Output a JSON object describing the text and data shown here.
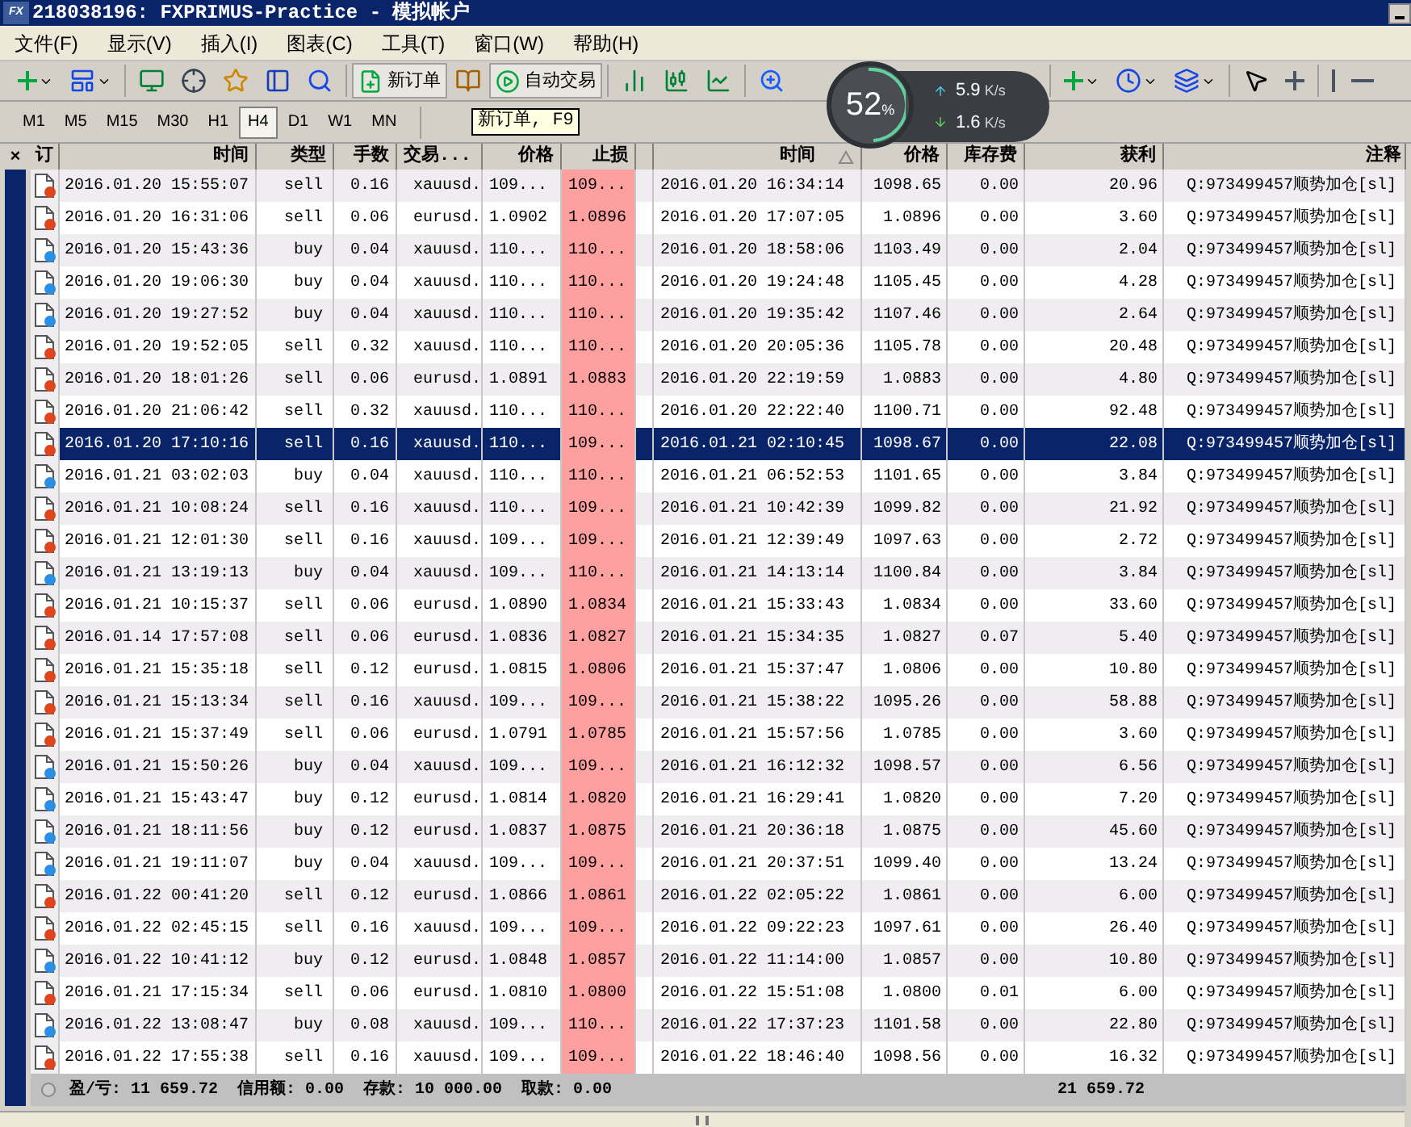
{
  "window": {
    "logo": "FX",
    "title": "218038196: FXPRIMUS-Practice - 模拟帐户"
  },
  "terminal_close": "×",
  "menu": [
    "文件(F)",
    "显示(V)",
    "插入(I)",
    "图表(C)",
    "工具(T)",
    "窗口(W)",
    "帮助(H)"
  ],
  "toolbar": {
    "new_order": "新订单",
    "auto_trading": "自动交易"
  },
  "timeframes": [
    {
      "label": "M1",
      "selected": false
    },
    {
      "label": "M5",
      "selected": false
    },
    {
      "label": "M15",
      "selected": false
    },
    {
      "label": "M30",
      "selected": false
    },
    {
      "label": "H1",
      "selected": false
    },
    {
      "label": "H4",
      "selected": true
    },
    {
      "label": "D1",
      "selected": false
    },
    {
      "label": "W1",
      "selected": false
    },
    {
      "label": "MN",
      "selected": false
    }
  ],
  "tooltip": "新订单, F9",
  "speed_widget": {
    "percent": "52",
    "percent_sign": "%",
    "upload": "5.9",
    "upload_unit": "K/s",
    "download": "1.6",
    "download_unit": "K/s"
  },
  "table": {
    "order_column": "订",
    "columns": [
      "时间",
      "类型",
      "手数",
      "交易...",
      "价格",
      "止损",
      "时间",
      "价格",
      "库存费",
      "获利",
      "注释"
    ],
    "rows": [
      {
        "kind": "sell",
        "selected": false,
        "cells": [
          "2016.01.20 15:55:07",
          "sell",
          "0.16",
          "xauusd.",
          "109...",
          "109...",
          "2016.01.20 16:34:14",
          "1098.65",
          "0.00",
          "20.96",
          "Q:973499457顺势加仓[sl]"
        ]
      },
      {
        "kind": "sell",
        "selected": false,
        "cells": [
          "2016.01.20 16:31:06",
          "sell",
          "0.06",
          "eurusd.",
          "1.0902",
          "1.0896",
          "2016.01.20 17:07:05",
          "1.0896",
          "0.00",
          "3.60",
          "Q:973499457顺势加仓[sl]"
        ]
      },
      {
        "kind": "buy",
        "selected": false,
        "cells": [
          "2016.01.20 15:43:36",
          "buy",
          "0.04",
          "xauusd.",
          "110...",
          "110...",
          "2016.01.20 18:58:06",
          "1103.49",
          "0.00",
          "2.04",
          "Q:973499457顺势加仓[sl]"
        ]
      },
      {
        "kind": "buy",
        "selected": false,
        "cells": [
          "2016.01.20 19:06:30",
          "buy",
          "0.04",
          "xauusd.",
          "110...",
          "110...",
          "2016.01.20 19:24:48",
          "1105.45",
          "0.00",
          "4.28",
          "Q:973499457顺势加仓[sl]"
        ]
      },
      {
        "kind": "buy",
        "selected": false,
        "cells": [
          "2016.01.20 19:27:52",
          "buy",
          "0.04",
          "xauusd.",
          "110...",
          "110...",
          "2016.01.20 19:35:42",
          "1107.46",
          "0.00",
          "2.64",
          "Q:973499457顺势加仓[sl]"
        ]
      },
      {
        "kind": "sell",
        "selected": false,
        "cells": [
          "2016.01.20 19:52:05",
          "sell",
          "0.32",
          "xauusd.",
          "110...",
          "110...",
          "2016.01.20 20:05:36",
          "1105.78",
          "0.00",
          "20.48",
          "Q:973499457顺势加仓[sl]"
        ]
      },
      {
        "kind": "sell",
        "selected": false,
        "cells": [
          "2016.01.20 18:01:26",
          "sell",
          "0.06",
          "eurusd.",
          "1.0891",
          "1.0883",
          "2016.01.20 22:19:59",
          "1.0883",
          "0.00",
          "4.80",
          "Q:973499457顺势加仓[sl]"
        ]
      },
      {
        "kind": "sell",
        "selected": false,
        "cells": [
          "2016.01.20 21:06:42",
          "sell",
          "0.32",
          "xauusd.",
          "110...",
          "110...",
          "2016.01.20 22:22:40",
          "1100.71",
          "0.00",
          "92.48",
          "Q:973499457顺势加仓[sl]"
        ]
      },
      {
        "kind": "sell",
        "selected": true,
        "cells": [
          "2016.01.20 17:10:16",
          "sell",
          "0.16",
          "xauusd.",
          "110...",
          "109...",
          "2016.01.21 02:10:45",
          "1098.67",
          "0.00",
          "22.08",
          "Q:973499457顺势加仓[sl]"
        ]
      },
      {
        "kind": "buy",
        "selected": false,
        "cells": [
          "2016.01.21 03:02:03",
          "buy",
          "0.04",
          "xauusd.",
          "110...",
          "110...",
          "2016.01.21 06:52:53",
          "1101.65",
          "0.00",
          "3.84",
          "Q:973499457顺势加仓[sl]"
        ]
      },
      {
        "kind": "sell",
        "selected": false,
        "cells": [
          "2016.01.21 10:08:24",
          "sell",
          "0.16",
          "xauusd.",
          "110...",
          "109...",
          "2016.01.21 10:42:39",
          "1099.82",
          "0.00",
          "21.92",
          "Q:973499457顺势加仓[sl]"
        ]
      },
      {
        "kind": "sell",
        "selected": false,
        "cells": [
          "2016.01.21 12:01:30",
          "sell",
          "0.16",
          "xauusd.",
          "109...",
          "109...",
          "2016.01.21 12:39:49",
          "1097.63",
          "0.00",
          "2.72",
          "Q:973499457顺势加仓[sl]"
        ]
      },
      {
        "kind": "buy",
        "selected": false,
        "cells": [
          "2016.01.21 13:19:13",
          "buy",
          "0.04",
          "xauusd.",
          "109...",
          "110...",
          "2016.01.21 14:13:14",
          "1100.84",
          "0.00",
          "3.84",
          "Q:973499457顺势加仓[sl]"
        ]
      },
      {
        "kind": "sell",
        "selected": false,
        "cells": [
          "2016.01.21 10:15:37",
          "sell",
          "0.06",
          "eurusd.",
          "1.0890",
          "1.0834",
          "2016.01.21 15:33:43",
          "1.0834",
          "0.00",
          "33.60",
          "Q:973499457顺势加仓[sl]"
        ]
      },
      {
        "kind": "sell",
        "selected": false,
        "cells": [
          "2016.01.14 17:57:08",
          "sell",
          "0.06",
          "eurusd.",
          "1.0836",
          "1.0827",
          "2016.01.21 15:34:35",
          "1.0827",
          "0.07",
          "5.40",
          "Q:973499457顺势加仓[sl]"
        ]
      },
      {
        "kind": "sell",
        "selected": false,
        "cells": [
          "2016.01.21 15:35:18",
          "sell",
          "0.12",
          "eurusd.",
          "1.0815",
          "1.0806",
          "2016.01.21 15:37:47",
          "1.0806",
          "0.00",
          "10.80",
          "Q:973499457顺势加仓[sl]"
        ]
      },
      {
        "kind": "sell",
        "selected": false,
        "cells": [
          "2016.01.21 15:13:34",
          "sell",
          "0.16",
          "xauusd.",
          "109...",
          "109...",
          "2016.01.21 15:38:22",
          "1095.26",
          "0.00",
          "58.88",
          "Q:973499457顺势加仓[sl]"
        ]
      },
      {
        "kind": "sell",
        "selected": false,
        "cells": [
          "2016.01.21 15:37:49",
          "sell",
          "0.06",
          "eurusd.",
          "1.0791",
          "1.0785",
          "2016.01.21 15:57:56",
          "1.0785",
          "0.00",
          "3.60",
          "Q:973499457顺势加仓[sl]"
        ]
      },
      {
        "kind": "buy",
        "selected": false,
        "cells": [
          "2016.01.21 15:50:26",
          "buy",
          "0.04",
          "xauusd.",
          "109...",
          "109...",
          "2016.01.21 16:12:32",
          "1098.57",
          "0.00",
          "6.56",
          "Q:973499457顺势加仓[sl]"
        ]
      },
      {
        "kind": "buy",
        "selected": false,
        "cells": [
          "2016.01.21 15:43:47",
          "buy",
          "0.12",
          "eurusd.",
          "1.0814",
          "1.0820",
          "2016.01.21 16:29:41",
          "1.0820",
          "0.00",
          "7.20",
          "Q:973499457顺势加仓[sl]"
        ]
      },
      {
        "kind": "buy",
        "selected": false,
        "cells": [
          "2016.01.21 18:11:56",
          "buy",
          "0.12",
          "eurusd.",
          "1.0837",
          "1.0875",
          "2016.01.21 20:36:18",
          "1.0875",
          "0.00",
          "45.60",
          "Q:973499457顺势加仓[sl]"
        ]
      },
      {
        "kind": "buy",
        "selected": false,
        "cells": [
          "2016.01.21 19:11:07",
          "buy",
          "0.04",
          "xauusd.",
          "109...",
          "109...",
          "2016.01.21 20:37:51",
          "1099.40",
          "0.00",
          "13.24",
          "Q:973499457顺势加仓[sl]"
        ]
      },
      {
        "kind": "sell",
        "selected": false,
        "cells": [
          "2016.01.22 00:41:20",
          "sell",
          "0.12",
          "eurusd.",
          "1.0866",
          "1.0861",
          "2016.01.22 02:05:22",
          "1.0861",
          "0.00",
          "6.00",
          "Q:973499457顺势加仓[sl]"
        ]
      },
      {
        "kind": "sell",
        "selected": false,
        "cells": [
          "2016.01.22 02:45:15",
          "sell",
          "0.16",
          "xauusd.",
          "109...",
          "109...",
          "2016.01.22 09:22:23",
          "1097.61",
          "0.00",
          "26.40",
          "Q:973499457顺势加仓[sl]"
        ]
      },
      {
        "kind": "buy",
        "selected": false,
        "cells": [
          "2016.01.22 10:41:12",
          "buy",
          "0.12",
          "eurusd.",
          "1.0848",
          "1.0857",
          "2016.01.22 11:14:00",
          "1.0857",
          "0.00",
          "10.80",
          "Q:973499457顺势加仓[sl]"
        ]
      },
      {
        "kind": "sell",
        "selected": false,
        "cells": [
          "2016.01.21 17:15:34",
          "sell",
          "0.06",
          "eurusd.",
          "1.0810",
          "1.0800",
          "2016.01.22 15:51:08",
          "1.0800",
          "0.01",
          "6.00",
          "Q:973499457顺势加仓[sl]"
        ]
      },
      {
        "kind": "buy",
        "selected": false,
        "cells": [
          "2016.01.22 13:08:47",
          "buy",
          "0.08",
          "xauusd.",
          "109...",
          "110...",
          "2016.01.22 17:37:23",
          "1101.58",
          "0.00",
          "22.80",
          "Q:973499457顺势加仓[sl]"
        ]
      },
      {
        "kind": "sell",
        "selected": false,
        "cells": [
          "2016.01.22 17:55:38",
          "sell",
          "0.16",
          "xauusd.",
          "109...",
          "109...",
          "2016.01.22 18:46:40",
          "1098.56",
          "0.00",
          "16.32",
          "Q:973499457顺势加仓[sl]"
        ]
      }
    ],
    "summary": {
      "text": "盈/亏: 11 659.72  信用额: 0.00  存款: 10 000.00  取款: 0.00",
      "total_profit": "21 659.72"
    }
  }
}
